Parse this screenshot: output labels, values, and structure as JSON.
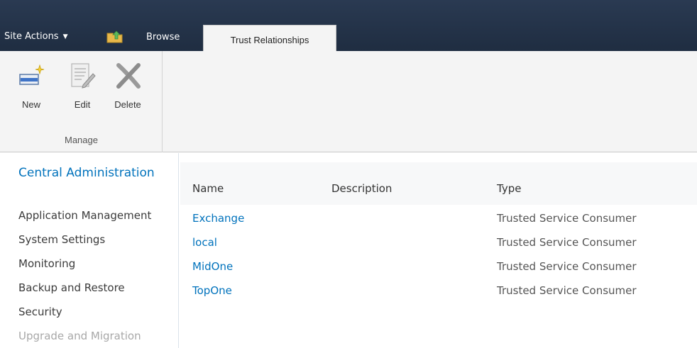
{
  "topbar": {
    "site_actions": "Site Actions",
    "tab_browse": "Browse",
    "tab_active": "Trust Relationships"
  },
  "ribbon": {
    "buttons": [
      {
        "label": "New",
        "icon": "new-item-icon"
      },
      {
        "label": "Edit",
        "icon": "edit-item-icon"
      },
      {
        "label": "Delete",
        "icon": "delete-item-icon"
      }
    ],
    "group_label": "Manage"
  },
  "leftnav": {
    "title": "Central Administration",
    "items": [
      {
        "label": "Application Management"
      },
      {
        "label": "System Settings"
      },
      {
        "label": "Monitoring"
      },
      {
        "label": "Backup and Restore"
      },
      {
        "label": "Security"
      },
      {
        "label": "Upgrade and Migration"
      }
    ]
  },
  "list": {
    "columns": [
      "Name",
      "Description",
      "Type"
    ],
    "rows": [
      {
        "name": "Exchange",
        "description": "",
        "type": "Trusted Service Consumer"
      },
      {
        "name": "local",
        "description": "",
        "type": "Trusted Service Consumer"
      },
      {
        "name": "MidOne",
        "description": "",
        "type": "Trusted Service Consumer"
      },
      {
        "name": "TopOne",
        "description": "",
        "type": "Trusted Service Consumer"
      }
    ]
  },
  "colors": {
    "topbar": "#1f2d41",
    "link": "#0072bc",
    "ribbon": "#f4f4f4"
  }
}
